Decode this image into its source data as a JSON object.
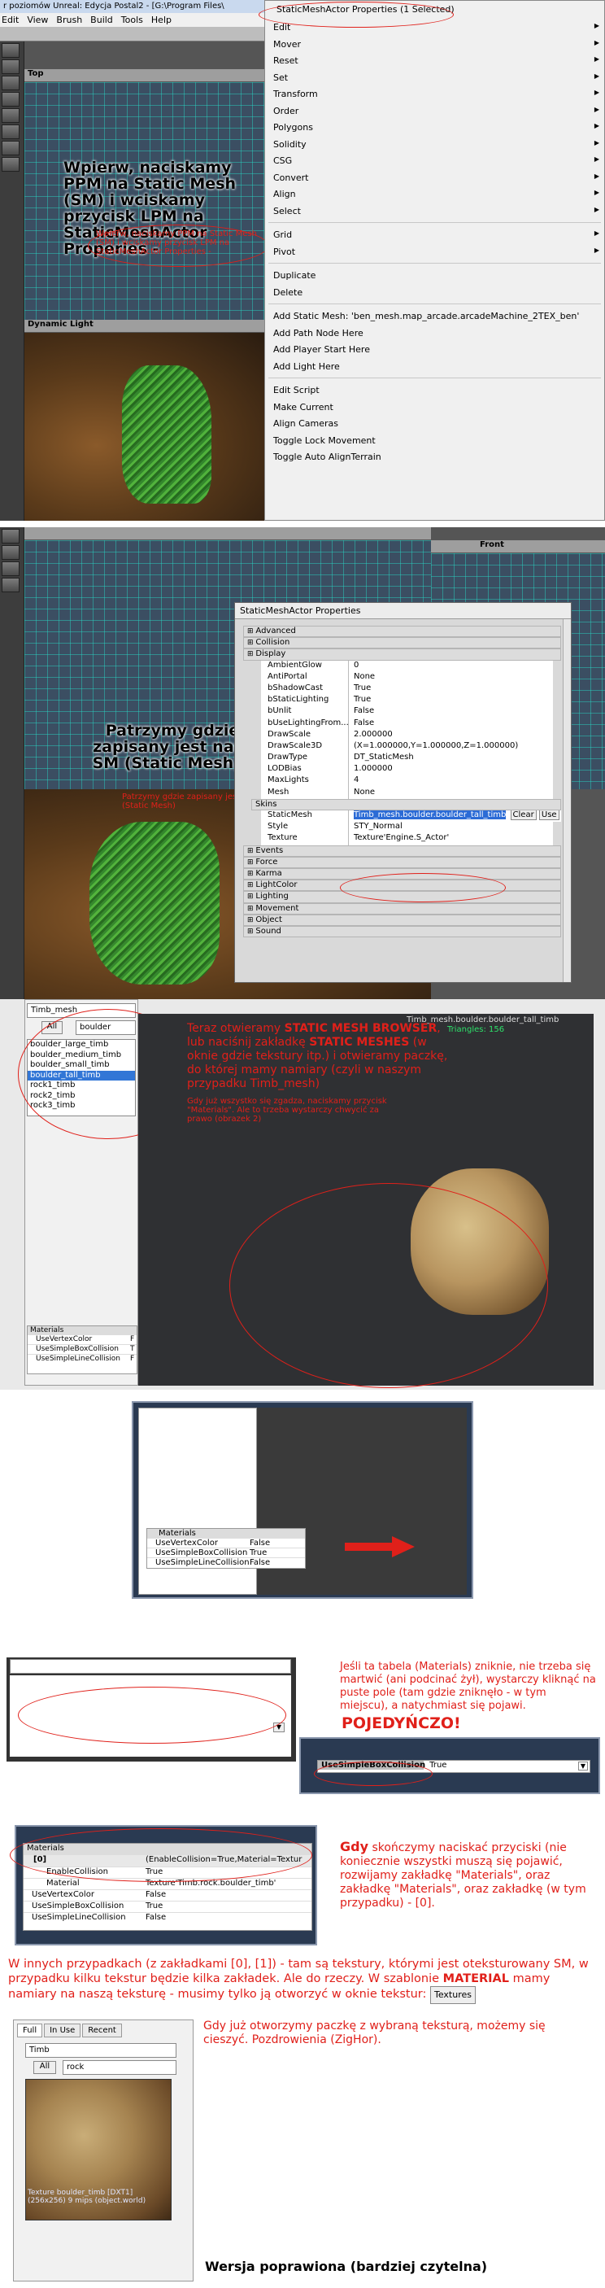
{
  "s1": {
    "title_bar": "r poziomów Unreal: Edycja Postal2 - [G:\\Program Files\\",
    "menubar": [
      "Edit",
      "View",
      "Brush",
      "Build",
      "Tools",
      "Help"
    ],
    "viewport_top_label": "Top",
    "viewport_light_label": "Dynamic Light",
    "caption": "Wpierw, naciskamy PPM na Static Mesh (SM) i wciskamy przycisk LPM na StaticMeshActor Properies -",
    "small_note": "Wpierw, naciskamy PPM na Static Mesh (SM) i wciskamy przycisk LPM na StaticMeshActor Properties -",
    "context_menu": {
      "title": "StaticMeshActor Properties (1 Selected)",
      "group1": [
        {
          "label": "Edit",
          "sub": true
        },
        {
          "label": "Mover",
          "sub": true
        },
        {
          "label": "Reset",
          "sub": true
        },
        {
          "label": "Set",
          "sub": true
        },
        {
          "label": "Transform",
          "sub": true
        },
        {
          "label": "Order",
          "sub": true
        },
        {
          "label": "Polygons",
          "sub": true
        },
        {
          "label": "Solidity",
          "sub": true
        },
        {
          "label": "CSG",
          "sub": true
        },
        {
          "label": "Convert",
          "sub": true
        },
        {
          "label": "Align",
          "sub": true
        },
        {
          "label": "Select",
          "sub": true
        }
      ],
      "group2": [
        {
          "label": "Grid",
          "sub": true
        },
        {
          "label": "Pivot",
          "sub": true
        }
      ],
      "group3": [
        {
          "label": "Duplicate",
          "sub": false
        },
        {
          "label": "Delete",
          "sub": false
        }
      ],
      "group4": [
        {
          "label": "Add Static Mesh: 'ben_mesh.map_arcade.arcadeMachine_2TEX_ben'",
          "sub": false
        },
        {
          "label": "Add Path Node Here",
          "sub": false
        },
        {
          "label": "Add Player Start Here",
          "sub": false
        },
        {
          "label": "Add Light Here",
          "sub": false
        }
      ],
      "group5": [
        {
          "label": "Edit Script",
          "sub": false
        },
        {
          "label": "Make Current",
          "sub": false
        },
        {
          "label": "Align Cameras",
          "sub": false
        },
        {
          "label": "Toggle Lock Movement",
          "sub": false
        },
        {
          "label": "Toggle Auto AlignTerrain",
          "sub": false
        }
      ]
    }
  },
  "s2": {
    "front_label": "Front",
    "caption": "Patrzymy gdzie zapisany jest nasz SM (Static Mesh) -",
    "small_note": "Patrzymy gdzie zapisany jest nasz SM (Static Mesh)",
    "window_title": "StaticMeshActor Properties",
    "cats_top": [
      "Advanced",
      "Collision",
      "Display"
    ],
    "display_rows": [
      {
        "k": "AmbientGlow",
        "v": "0"
      },
      {
        "k": "AntiPortal",
        "v": "None"
      },
      {
        "k": "bShadowCast",
        "v": "True"
      },
      {
        "k": "bStaticLighting",
        "v": "True"
      },
      {
        "k": "bUnlit",
        "v": "False"
      },
      {
        "k": "bUseLightingFrom...",
        "v": "False"
      },
      {
        "k": "DrawScale",
        "v": "2.000000"
      },
      {
        "k": "DrawScale3D",
        "v": "(X=1.000000,Y=1.000000,Z=1.000000)"
      },
      {
        "k": "DrawType",
        "v": "DT_StaticMesh"
      },
      {
        "k": "LODBias",
        "v": "1.000000"
      },
      {
        "k": "MaxLights",
        "v": "4"
      },
      {
        "k": "Mesh",
        "v": "None"
      }
    ],
    "skins_label": "Skins",
    "staticmesh_key": "StaticMesh",
    "staticmesh_val": "Timb_mesh.boulder.boulder_tall_timb",
    "clear_btn": "Clear",
    "use_btn": "Use",
    "more_btn": "...",
    "style_row": {
      "k": "Style",
      "v": "STY_Normal"
    },
    "texture_row": {
      "k": "Texture",
      "v": "Texture'Engine.S_Actor'"
    },
    "cats_bottom": [
      "Events",
      "Force",
      "Karma",
      "LightColor",
      "Lighting",
      "Movement",
      "Object",
      "Sound"
    ]
  },
  "s3": {
    "package_field": "Timb_mesh",
    "filter_all": "All",
    "group_field": "boulder",
    "mesh_list": [
      "boulder_large_timb",
      "boulder_medium_timb",
      "boulder_small_timb",
      "boulder_tall_timb",
      "rock1_timb",
      "rock2_timb",
      "rock3_timb"
    ],
    "selected_index": 3,
    "view_header": "Timb_mesh.boulder.boulder_tall_timb",
    "view_stats": "Triangles: 156",
    "text_pre": "Teraz otwieramy ",
    "text_b1": "STATIC MESH BROWSER",
    "text_mid1": ", lub naciśnij zakładkę ",
    "text_b2": "STATIC MESHES",
    "text_rest": " (w oknie gdzie tekstury itp.) i otwieramy paczkę, do której mamy namiary (czyli w naszym przypadku Timb_mesh)",
    "small_note": "Gdy już wszystko się zgadza, naciskamy przycisk \"Materials\". Ale to trzeba wystarczy chwycić za prawo (obrazek 2)",
    "materials_header": "Materials",
    "materials_rows": [
      {
        "k": "UseVertexColor",
        "v": "F"
      },
      {
        "k": "UseSimpleBoxCollision",
        "v": "T"
      },
      {
        "k": "UseSimpleLineCollision",
        "v": "F"
      }
    ]
  },
  "s4": {
    "materials_header": "Materials",
    "rows": [
      {
        "k": "UseVertexColor",
        "v": "False"
      },
      {
        "k": "UseSimpleBoxCollision",
        "v": "True"
      },
      {
        "k": "UseSimpleLineCollision",
        "v": "False"
      }
    ]
  },
  "s5": {
    "text": "Jeśli ta tabela (Materials) zniknie, nie trzeba się martwić (ani podcinać żył), wystarczy kliknąć na puste pole (tam gdzie zniknęło - w tym miejscu), a natychmiast się pojawi.",
    "bold": "POJEDYŃCZO!",
    "row_key": "UseSimpleBoxCollision",
    "row_val": "True"
  },
  "s6": {
    "materials_header": "Materials",
    "group_key": "[0]",
    "group_val": "(EnableCollision=True,Material=Textur",
    "rows": [
      {
        "k": "EnableCollision",
        "v": "True"
      },
      {
        "k": "Material",
        "v": "Texture'Timb.rock.boulder_timb'"
      },
      {
        "k": "UseVertexColor",
        "v": "False"
      },
      {
        "k": "UseSimpleBoxCollision",
        "v": "True"
      },
      {
        "k": "UseSimpleLineCollision",
        "v": "False"
      }
    ],
    "text_b": "Gdy",
    "text_rest": " skończymy naciskać przyciski (nie koniecznie wszystki muszą się pojawić, rozwijamy zakładkę \"Materials\", oraz zakładkę \"Materials\", oraz zakładkę (w tym przypadku) - [0]."
  },
  "s7": {
    "text_pre": "W innych przypadkach (z zakładkami [0], [1]) - tam są tekstury, którymi jest oteksturowany SM, w przypadku kilku tekstur będzie kilka zakładek. Ale do rzeczy. W szablonie ",
    "text_b": "MATERIAL",
    "text_post": " mamy namiary na naszą teksturę - musimy tylko ją otworzyć w oknie tekstur:",
    "button": "Textures"
  },
  "s8": {
    "tabs": [
      "Full",
      "In Use",
      "Recent"
    ],
    "package_field": "Timb",
    "filter_all": "All",
    "group_field": "rock",
    "thumb_label1": "Texture boulder_timb [DXT1]",
    "thumb_label2": "(256x256) 9 mips (object.world)",
    "text": "Gdy już otworzymy paczkę z wybraną teksturą, możemy się cieszyć. Pozdrowienia (ZigHor).",
    "footer": "Wersja poprawiona (bardziej czytelna)"
  }
}
